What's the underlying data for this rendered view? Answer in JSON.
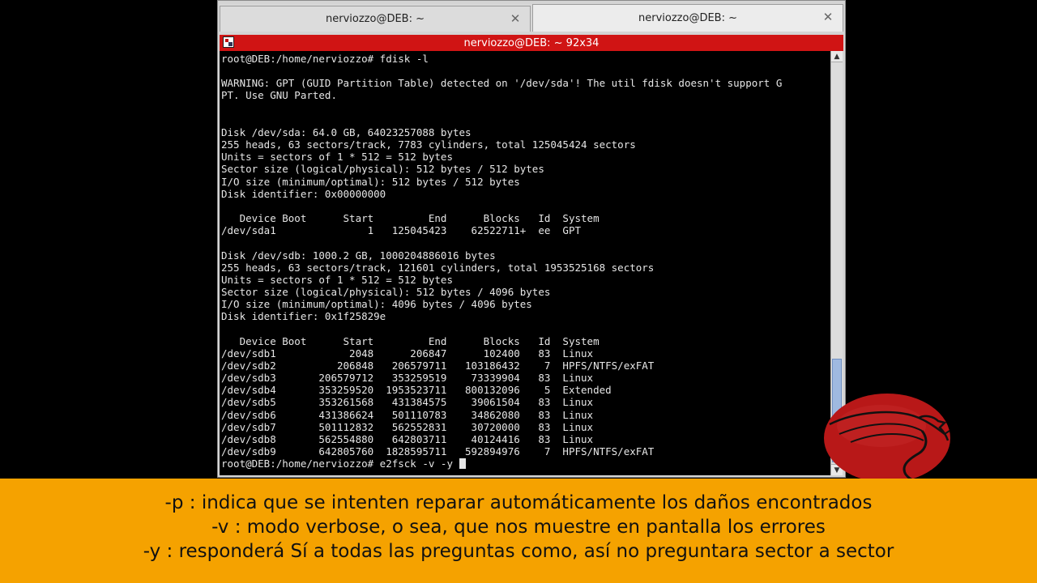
{
  "tabs": [
    {
      "label": "nerviozzo@DEB: ~",
      "close": "✕"
    },
    {
      "label": "nerviozzo@DEB: ~",
      "close": "✕"
    }
  ],
  "window_title": "nerviozzo@DEB: ~ 92x34",
  "terminal": {
    "output": "root@DEB:/home/nerviozzo# fdisk -l\n\nWARNING: GPT (GUID Partition Table) detected on '/dev/sda'! The util fdisk doesn't support G\nPT. Use GNU Parted.\n\n\nDisk /dev/sda: 64.0 GB, 64023257088 bytes\n255 heads, 63 sectors/track, 7783 cylinders, total 125045424 sectors\nUnits = sectors of 1 * 512 = 512 bytes\nSector size (logical/physical): 512 bytes / 512 bytes\nI/O size (minimum/optimal): 512 bytes / 512 bytes\nDisk identifier: 0x00000000\n\n   Device Boot      Start         End      Blocks   Id  System\n/dev/sda1               1   125045423    62522711+  ee  GPT\n\nDisk /dev/sdb: 1000.2 GB, 1000204886016 bytes\n255 heads, 63 sectors/track, 121601 cylinders, total 1953525168 sectors\nUnits = sectors of 1 * 512 = 512 bytes\nSector size (logical/physical): 512 bytes / 4096 bytes\nI/O size (minimum/optimal): 4096 bytes / 4096 bytes\nDisk identifier: 0x1f25829e\n\n   Device Boot      Start         End      Blocks   Id  System\n/dev/sdb1            2048      206847      102400   83  Linux\n/dev/sdb2          206848   206579711   103186432    7  HPFS/NTFS/exFAT\n/dev/sdb3       206579712   353259519    73339904   83  Linux\n/dev/sdb4       353259520  1953523711   800132096    5  Extended\n/dev/sdb5       353261568   431384575    39061504   83  Linux\n/dev/sdb6       431386624   501110783    34862080   83  Linux\n/dev/sdb7       501112832   562552831    30720000   83  Linux\n/dev/sdb8       562554880   642803711    40124416   83  Linux\n/dev/sdb9       642805760  1828595711   592894976    7  HPFS/NTFS/exFAT",
    "prompt_line": "root@DEB:/home/nerviozzo# e2fsck -v -y "
  },
  "subtitles": [
    "-p : indica que se intenten reparar automáticamente los daños encontrados",
    "-v : modo verbose, o sea, que nos muestre en pantalla los errores",
    "-y : responderá Sí a todas las preguntas como, así no preguntara sector a sector"
  ],
  "colors": {
    "titlebar": "#d01414",
    "subtitle_band": "#f5a200",
    "logo_disc": "#b81818"
  },
  "icons": {
    "tab_close": "close-icon",
    "window_menu": "terminal-menu-icon",
    "logo": "kali-dragon-logo"
  }
}
